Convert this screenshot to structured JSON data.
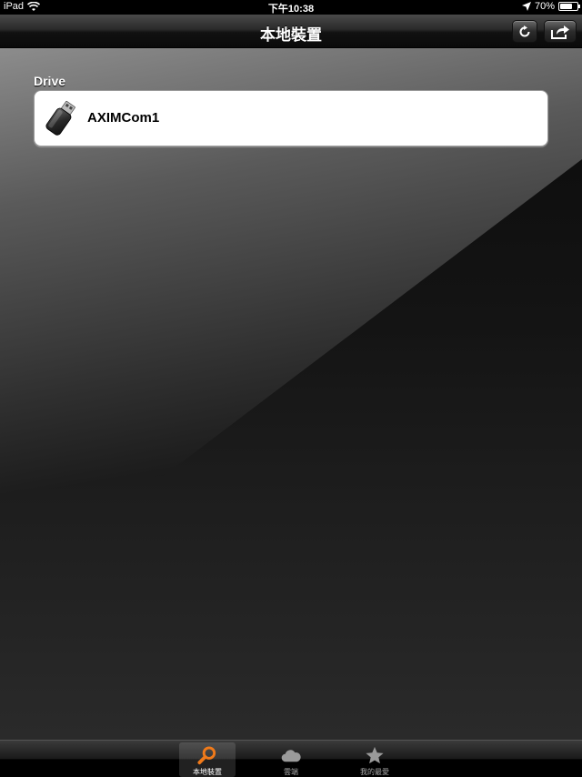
{
  "status_bar": {
    "device": "iPad",
    "time": "下午10:38",
    "battery": "70%",
    "battery_level": 0.7
  },
  "nav_bar": {
    "title": "本地裝置",
    "refresh_icon": "refresh-icon",
    "share_icon": "share-icon"
  },
  "content": {
    "section_header": "Drive",
    "drives": [
      {
        "label": "AXIMCom1",
        "icon": "usb-drive-icon"
      }
    ]
  },
  "tab_bar": {
    "tabs": [
      {
        "label": "本地裝置",
        "icon": "search-icon",
        "selected": true
      },
      {
        "label": "雲端",
        "icon": "cloud-icon",
        "selected": false
      },
      {
        "label": "我的最愛",
        "icon": "star-icon",
        "selected": false
      }
    ]
  },
  "colors": {
    "accent": "#f07a1a",
    "item_bg": "#ffffff"
  }
}
